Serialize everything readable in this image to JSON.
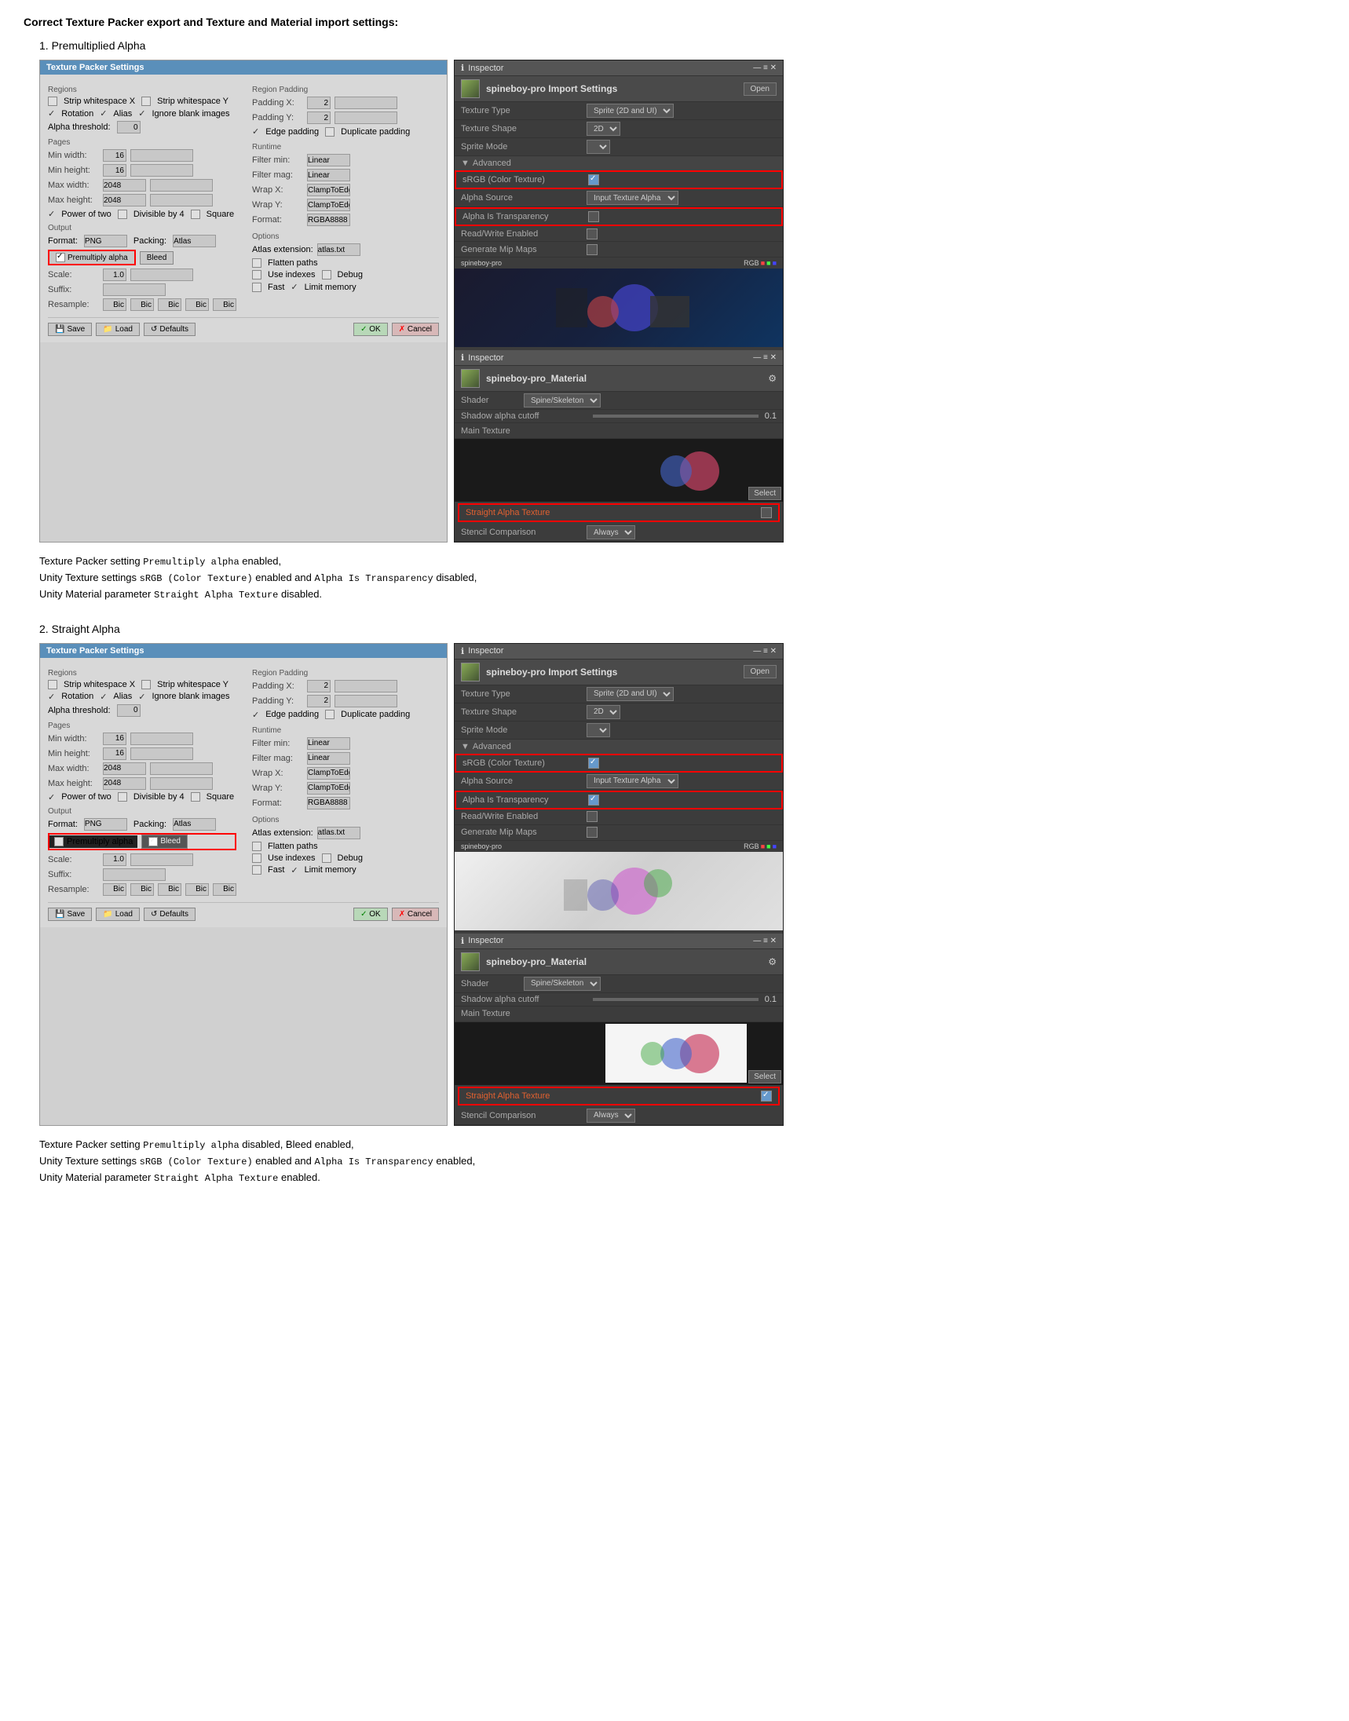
{
  "page": {
    "heading": "Correct Texture Packer export and Texture and Material import settings:",
    "section1": {
      "title": "1. Premultiplied Alpha",
      "description1": "Texture Packer setting  Premultiply alpha  enabled,",
      "description2": "Unity Texture settings  sRGB (Color Texture)  enabled and  Alpha Is Transparency  disabled,",
      "description3": "Unity Material parameter  Straight Alpha Texture  disabled."
    },
    "section2": {
      "title": "2. Straight Alpha",
      "description1": "Texture Packer setting  Premultiply alpha  disabled, Bleed enabled,",
      "description2": "Unity Texture settings  sRGB (Color Texture)  enabled and  Alpha Is Transparency  enabled,",
      "description3": "Unity Material parameter  Straight Alpha Texture  enabled."
    },
    "texturePacker": {
      "title": "Texture Packer Settings",
      "regions_label": "Regions",
      "strip_whitespace_x": "Strip whitespace X",
      "strip_whitespace_y": "Strip whitespace Y",
      "rotation": "Rotation",
      "alias": "Alias",
      "ignore_blank": "Ignore blank images",
      "alpha_threshold_label": "Alpha threshold:",
      "alpha_threshold_value": "0",
      "region_padding_label": "Region Padding",
      "padding_x_label": "Padding X:",
      "padding_x_value": "2",
      "padding_y_label": "Padding Y:",
      "padding_y_value": "2",
      "edge_padding": "Edge padding",
      "duplicate_padding": "Duplicate padding",
      "pages_label": "Pages",
      "min_width_label": "Min width:",
      "min_width_value": "16",
      "min_height_label": "Min height:",
      "min_height_value": "16",
      "max_width_label": "Max width:",
      "max_width_value": "2048",
      "max_height_label": "Max height:",
      "max_height_value": "2048",
      "power_of_two": "Power of two",
      "divisible_by_4": "Divisible by 4",
      "square": "Square",
      "runtime_label": "Runtime",
      "filter_min_label": "Filter min:",
      "filter_min_value": "Linear",
      "filter_mag_label": "Filter mag:",
      "filter_mag_value": "Linear",
      "wrap_x_label": "Wrap X:",
      "wrap_x_value": "ClampToEdge",
      "wrap_y_label": "Wrap Y:",
      "wrap_y_value": "ClampToEdge",
      "format_label2": "Format:",
      "format_value2": "RGBA8888",
      "output_label": "Output",
      "format_label": "Format:",
      "format_value": "PNG",
      "packing_label": "Packing:",
      "packing_value": "Atlas",
      "premultiply_alpha": "Premultiply alpha",
      "bleed": "Bleed",
      "scale_label": "Scale:",
      "scale_value": "1.0",
      "suffix_label": "Suffix:",
      "resample_label": "Resample:",
      "resample_values": [
        "Bic",
        "Bic",
        "Bic",
        "Bic",
        "Bic"
      ],
      "options_label": "Options",
      "atlas_extension_label": "Atlas extension:",
      "atlas_extension_value": "atlas.txt",
      "flatten_paths": "Flatten paths",
      "use_indexes": "Use indexes",
      "debug": "Debug",
      "fast": "Fast",
      "limit_memory": "Limit memory",
      "save_btn": "Save",
      "load_btn": "Load",
      "defaults_btn": "Defaults",
      "ok_btn": "OK",
      "cancel_btn": "Cancel"
    },
    "unityTexture": {
      "inspector_label": "Inspector",
      "asset_name": "spineboy-pro Import Settings",
      "open_btn": "Open",
      "texture_type_label": "Texture Type",
      "texture_type_value": "Sprite (2D and UI)",
      "texture_shape_label": "Texture Shape",
      "texture_shape_value": "2D",
      "sprite_mode_label": "Sprite Mode",
      "advanced_label": "Advanced",
      "srgb_label": "sRGB (Color Texture)",
      "alpha_source_label": "Alpha Source",
      "alpha_source_value": "Input Texture Alpha",
      "alpha_transparency_label": "Alpha Is Transparency",
      "read_write_label": "Read/Write Enabled",
      "generate_mip_label": "Generate Mip Maps",
      "asset_file": "spineboy-pro"
    },
    "unityMaterial": {
      "inspector_label": "Inspector",
      "asset_name": "spineboy-pro_Material",
      "shader_label": "Shader",
      "shader_value": "Spine/Skeleton",
      "shadow_alpha_label": "Shadow alpha cutoff",
      "shadow_alpha_value": "0.1",
      "main_texture_label": "Main Texture",
      "straight_alpha_label": "Straight Alpha Texture",
      "stencil_label": "Stencil Comparison",
      "stencil_value": "Always"
    }
  }
}
